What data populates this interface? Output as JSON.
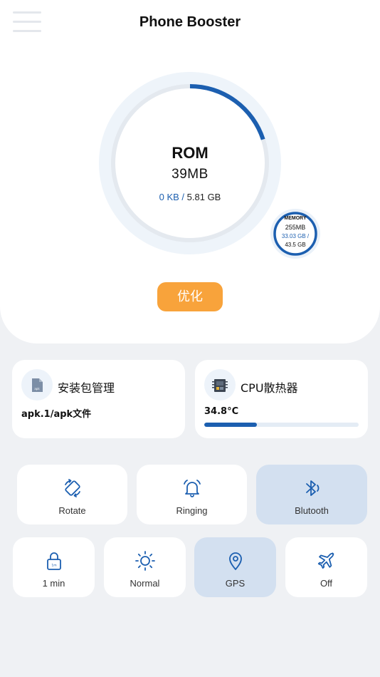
{
  "header": {
    "title": "Phone Booster"
  },
  "rom": {
    "label": "ROM",
    "value": "39MB",
    "used": "0 KB",
    "separator": " / ",
    "total": "5.81 GB",
    "progress_fraction": 0.2
  },
  "memory": {
    "label": "MEMORY",
    "value": "255MB",
    "used": "33.03 GB /",
    "total": "43.5 GB",
    "progress_fraction": 1.0
  },
  "optimize_button": "优化",
  "cards": {
    "apk": {
      "title": "安装包管理",
      "subtitle": "apk.1/apk文件",
      "icon": "apk-file-icon"
    },
    "cpu": {
      "title": "CPU散热器",
      "subtitle": "34.8°C",
      "icon": "cpu-chip-icon",
      "temp_fraction": 0.34
    }
  },
  "toggles_row1": [
    {
      "label": "Rotate",
      "icon": "rotate-icon",
      "active": false
    },
    {
      "label": "Ringing",
      "icon": "bell-icon",
      "active": false
    },
    {
      "label": "Blutooth",
      "icon": "bluetooth-icon",
      "active": true
    }
  ],
  "toggles_row2": [
    {
      "label": "1 min",
      "icon": "lock-icon",
      "active": false
    },
    {
      "label": "Normal",
      "icon": "brightness-icon",
      "active": false
    },
    {
      "label": "GPS",
      "icon": "location-icon",
      "active": true
    },
    {
      "label": "Off",
      "icon": "airplane-icon",
      "active": false
    }
  ],
  "colors": {
    "accent": "#1c5fb0",
    "orange": "#f8a33b",
    "active_tile": "#d3e0f0",
    "background": "#eff1f4"
  }
}
